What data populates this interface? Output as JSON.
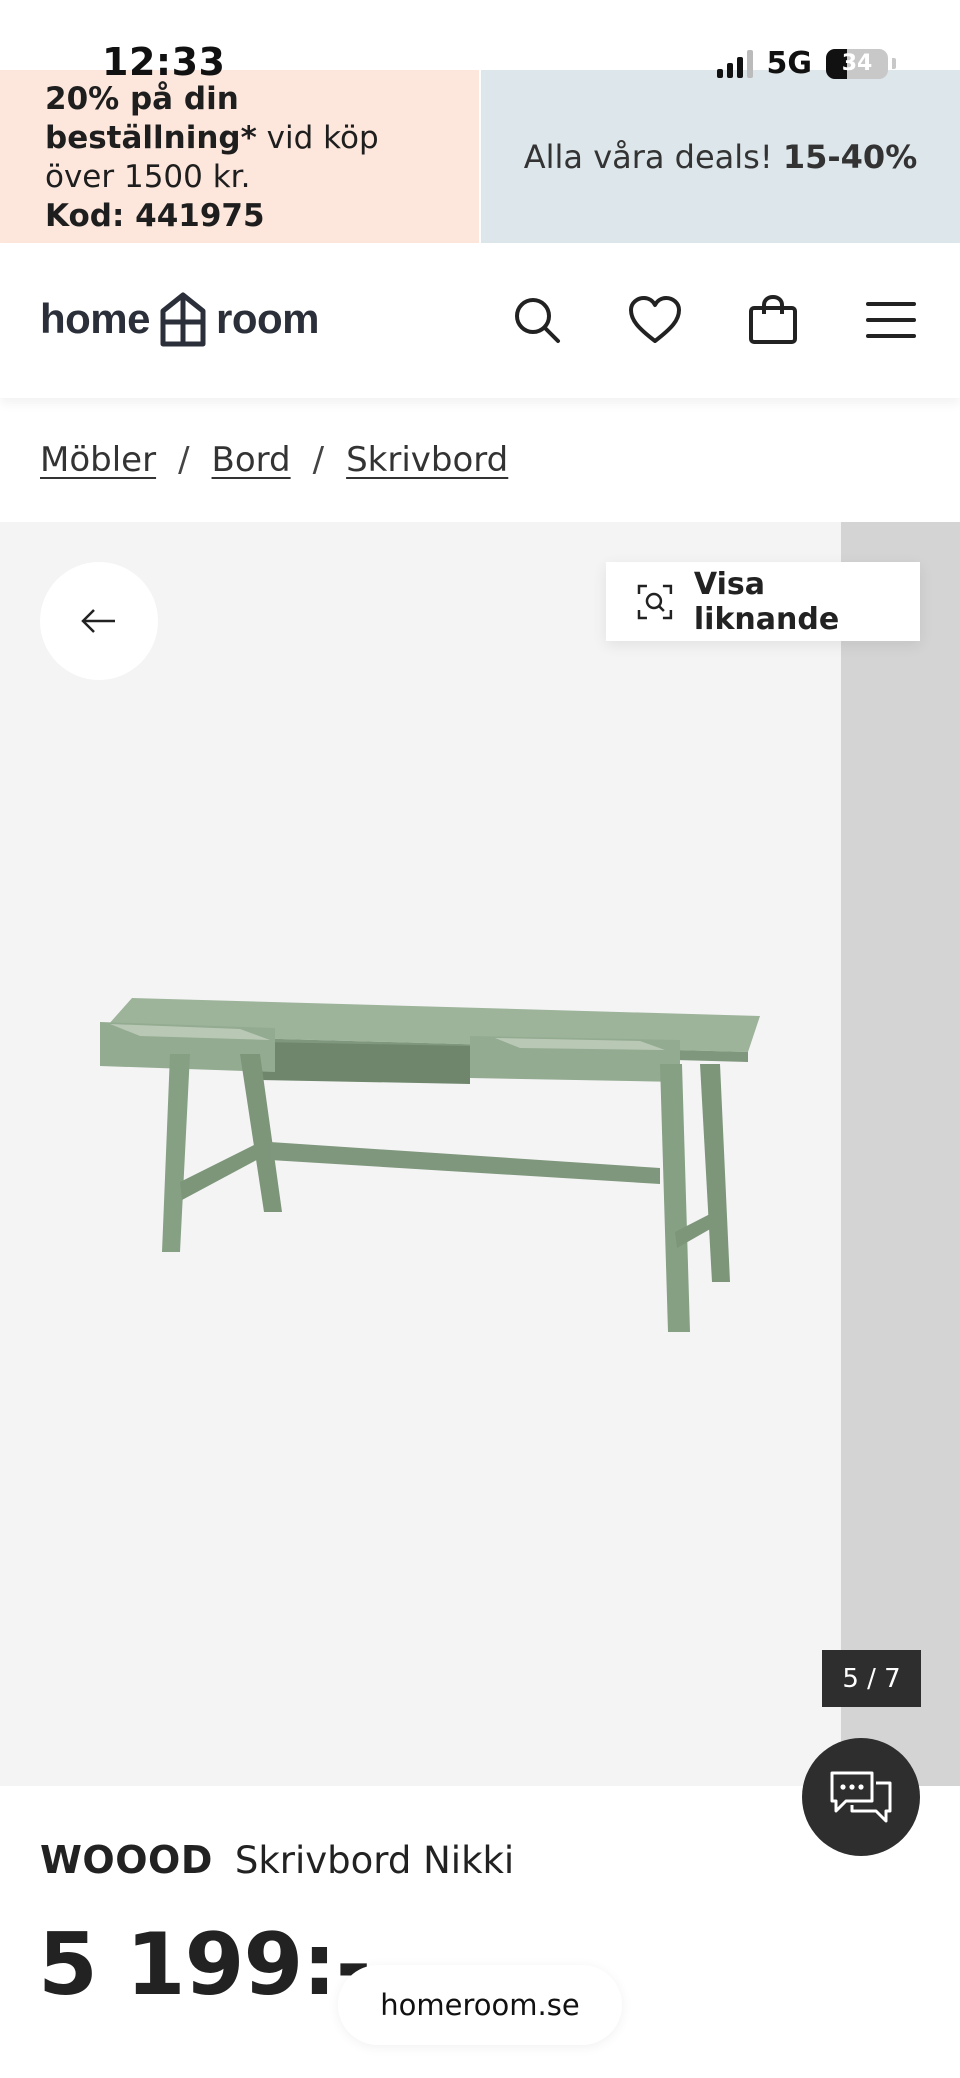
{
  "status_bar": {
    "time": "12:33",
    "network": "5G",
    "battery": "34",
    "battery_level": 0.34
  },
  "promo": {
    "left": {
      "line1_bold": "20% på din",
      "line2_bold": "beställning*",
      "line2_rest": " vid köp",
      "line3": "över 1500 kr.",
      "line4_bold": "Kod: 441975"
    },
    "right": {
      "text": "Alla våra deals! ",
      "bold": "15-40%"
    }
  },
  "header": {
    "logo_left": "home",
    "logo_right": "room",
    "icons": [
      "search-icon",
      "heart-icon",
      "bag-icon",
      "menu-icon"
    ]
  },
  "breadcrumb": {
    "items": [
      "Möbler",
      "Bord",
      "Skrivbord"
    ],
    "separator": "/"
  },
  "gallery": {
    "similar_label": "Visa liknande",
    "counter": "5 / 7",
    "product_color": "#8da68b"
  },
  "product": {
    "brand": "WOOOD",
    "name": "Skrivbord Nikki",
    "price": "5 199:-"
  },
  "browser": {
    "url": "homeroom.se"
  }
}
